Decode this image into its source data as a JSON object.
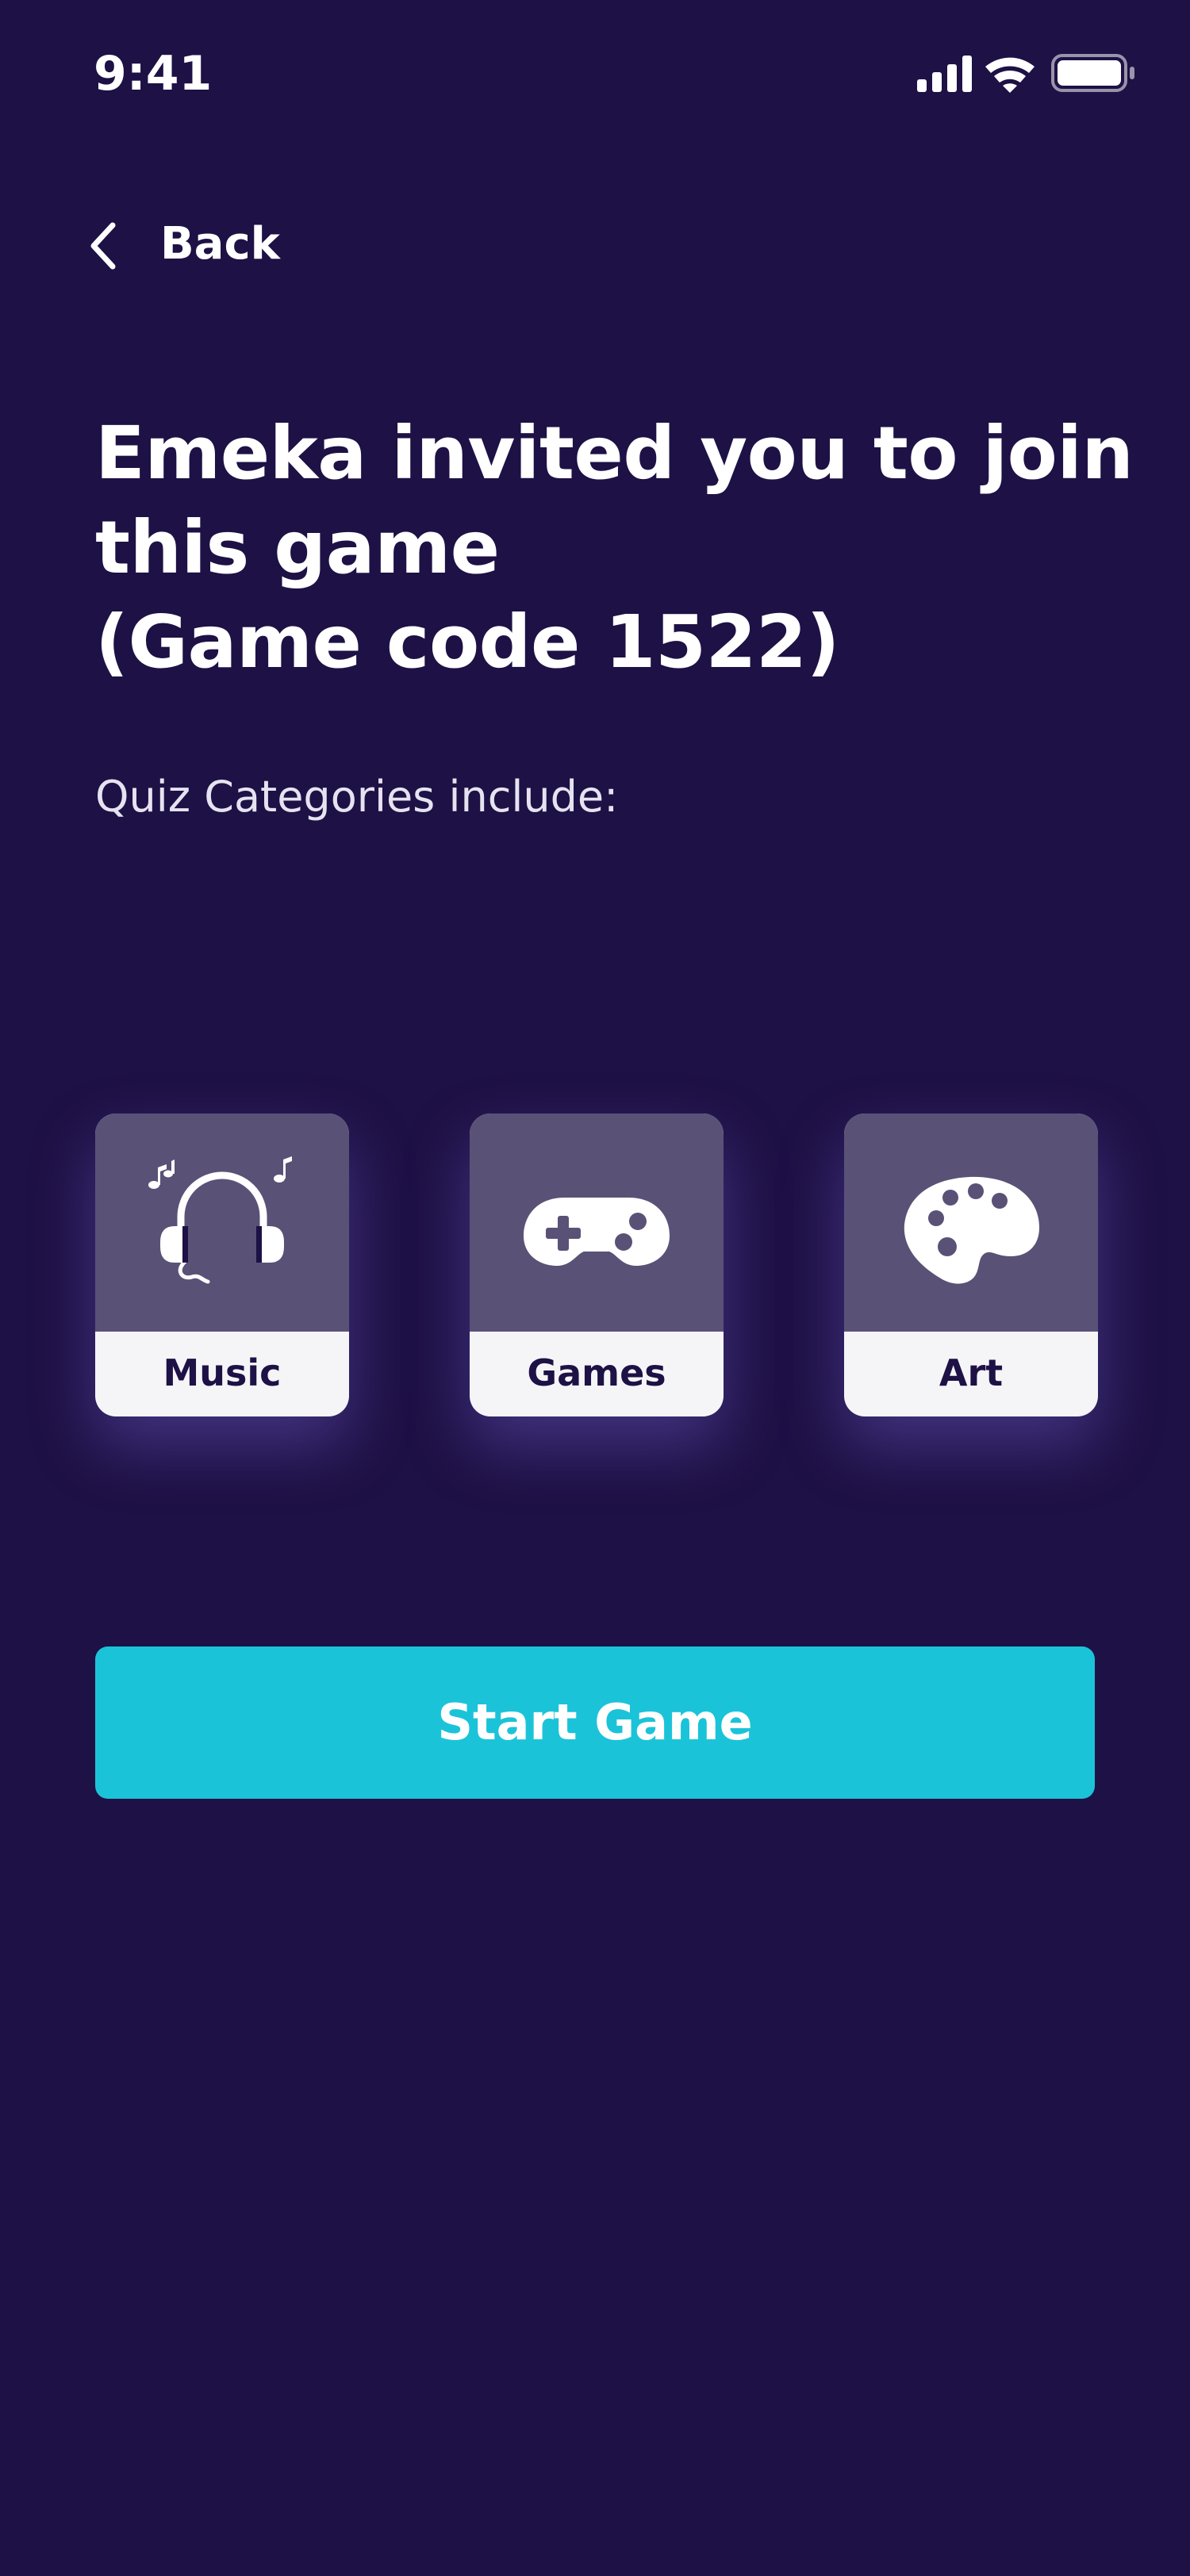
{
  "status_bar": {
    "time": "9:41",
    "icons": [
      "signal-icon",
      "wifi-icon",
      "battery-icon"
    ]
  },
  "nav": {
    "back_label": "Back",
    "back_icon": "chevron-left-icon"
  },
  "header": {
    "title_lines": [
      "Emeka invited you to join",
      "this game",
      "(Game code 1522)"
    ]
  },
  "categories": {
    "heading": "Quiz Categories include:",
    "items": [
      {
        "label": "Music",
        "icon": "headphones-icon"
      },
      {
        "label": "Games",
        "icon": "gamepad-icon"
      },
      {
        "label": "Art",
        "icon": "palette-icon"
      }
    ]
  },
  "actions": {
    "start_label": "Start Game"
  },
  "colors": {
    "background": "#1e1145",
    "card_top": "#5a5177",
    "card_bottom": "#f5f5f8",
    "accent": "#1bc3d9",
    "text": "#ffffff"
  }
}
